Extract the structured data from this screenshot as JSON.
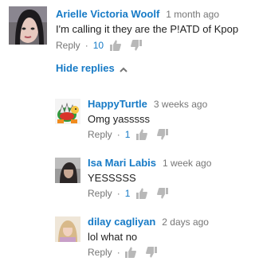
{
  "main_comment": {
    "author": "Arielle Victoria Woolf",
    "time": "1 month ago",
    "text": "I'm calling it they are the P!ATD of Kpop",
    "reply_label": "Reply",
    "separator": "·",
    "likes": "10"
  },
  "hide_replies_label": "Hide replies",
  "replies": [
    {
      "author": "HappyTurtle",
      "time": "3 weeks ago",
      "text": "Omg yasssss",
      "reply_label": "Reply",
      "separator": "·",
      "likes": "1"
    },
    {
      "author": "Isa Mari Labis",
      "time": "1 week ago",
      "text": "YESSSSS",
      "reply_label": "Reply",
      "separator": "·",
      "likes": "1"
    },
    {
      "author": "dilay cagliyan",
      "time": "2 days ago",
      "text": "lol what no",
      "reply_label": "Reply",
      "separator": "·",
      "likes": ""
    }
  ],
  "icons": {
    "like": "thumbs-up-icon",
    "dislike": "thumbs-down-icon",
    "caret": "chevron-up-icon"
  },
  "colors": {
    "link_blue": "#167ac6",
    "meta_gray": "#767676",
    "icon_gray": "#b8b8b8",
    "text": "#222222"
  }
}
